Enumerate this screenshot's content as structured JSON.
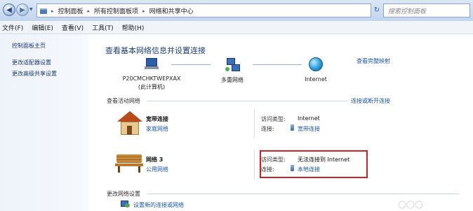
{
  "address_bar": {
    "crumbs": [
      "控制面板",
      "所有控制面板项",
      "网络和共享中心"
    ],
    "search_placeholder": "搜索控制面板"
  },
  "menu": [
    "文件(F)",
    "编辑(E)",
    "查看(V)",
    "工具(T)",
    "帮助(H)"
  ],
  "left_pane": {
    "links": [
      "控制面板主页",
      "更改适配器设置",
      "更改高级共享设置"
    ]
  },
  "main": {
    "title": "查看基本网络信息并设置连接",
    "view_full_map": "查看完整映射",
    "map": {
      "computer_name": "P20CMCHKTWEPXAX",
      "computer_sub": "(此计算机)",
      "middle_label": "多重网络",
      "internet_label": "Internet"
    },
    "active_networks_label": "查看活动网络",
    "connect_disconnect": "连接或断开连接",
    "networks": [
      {
        "name": "宽带连接",
        "type": "家庭网络",
        "access_key": "访问类型:",
        "access_value": "Internet",
        "conn_key": "连接:",
        "conn_value": "宽带连接"
      },
      {
        "name": "网络 3",
        "type": "公用网络",
        "access_key": "访问类型:",
        "access_value": "无法连接到 Internet",
        "conn_key": "连接:",
        "conn_value": "本地连接"
      }
    ],
    "change_settings_label": "更改网络设置",
    "setup_link": "设置新的连接或网络"
  }
}
